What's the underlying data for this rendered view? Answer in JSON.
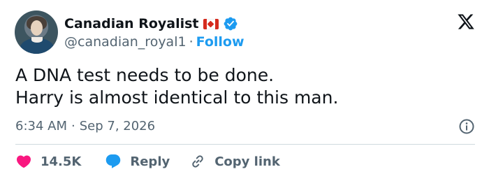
{
  "author": {
    "display_name": "Canadian Royalist",
    "handle": "@canadian_royal1",
    "separator": "·",
    "follow_label": "Follow",
    "verified": true,
    "flag": "canada-flag"
  },
  "tweet": {
    "lines": [
      "A DNA test needs to be done.",
      "Harry is almost identical to this man."
    ]
  },
  "meta": {
    "time": "6:34 AM",
    "separator": "·",
    "date": "Sep 7, 2026"
  },
  "actions": {
    "likes": "14.5K",
    "reply_label": "Reply",
    "copy_link_label": "Copy link"
  },
  "colors": {
    "accent": "#1d9bf0",
    "like": "#f91880",
    "text": "#0f1419",
    "muted": "#536471",
    "divider": "#cfd9de"
  },
  "icons": {
    "logo": "x-logo-icon",
    "verified": "verified-badge-icon",
    "info": "info-icon",
    "like": "heart-icon",
    "reply": "speech-bubble-icon",
    "copy": "link-icon"
  }
}
